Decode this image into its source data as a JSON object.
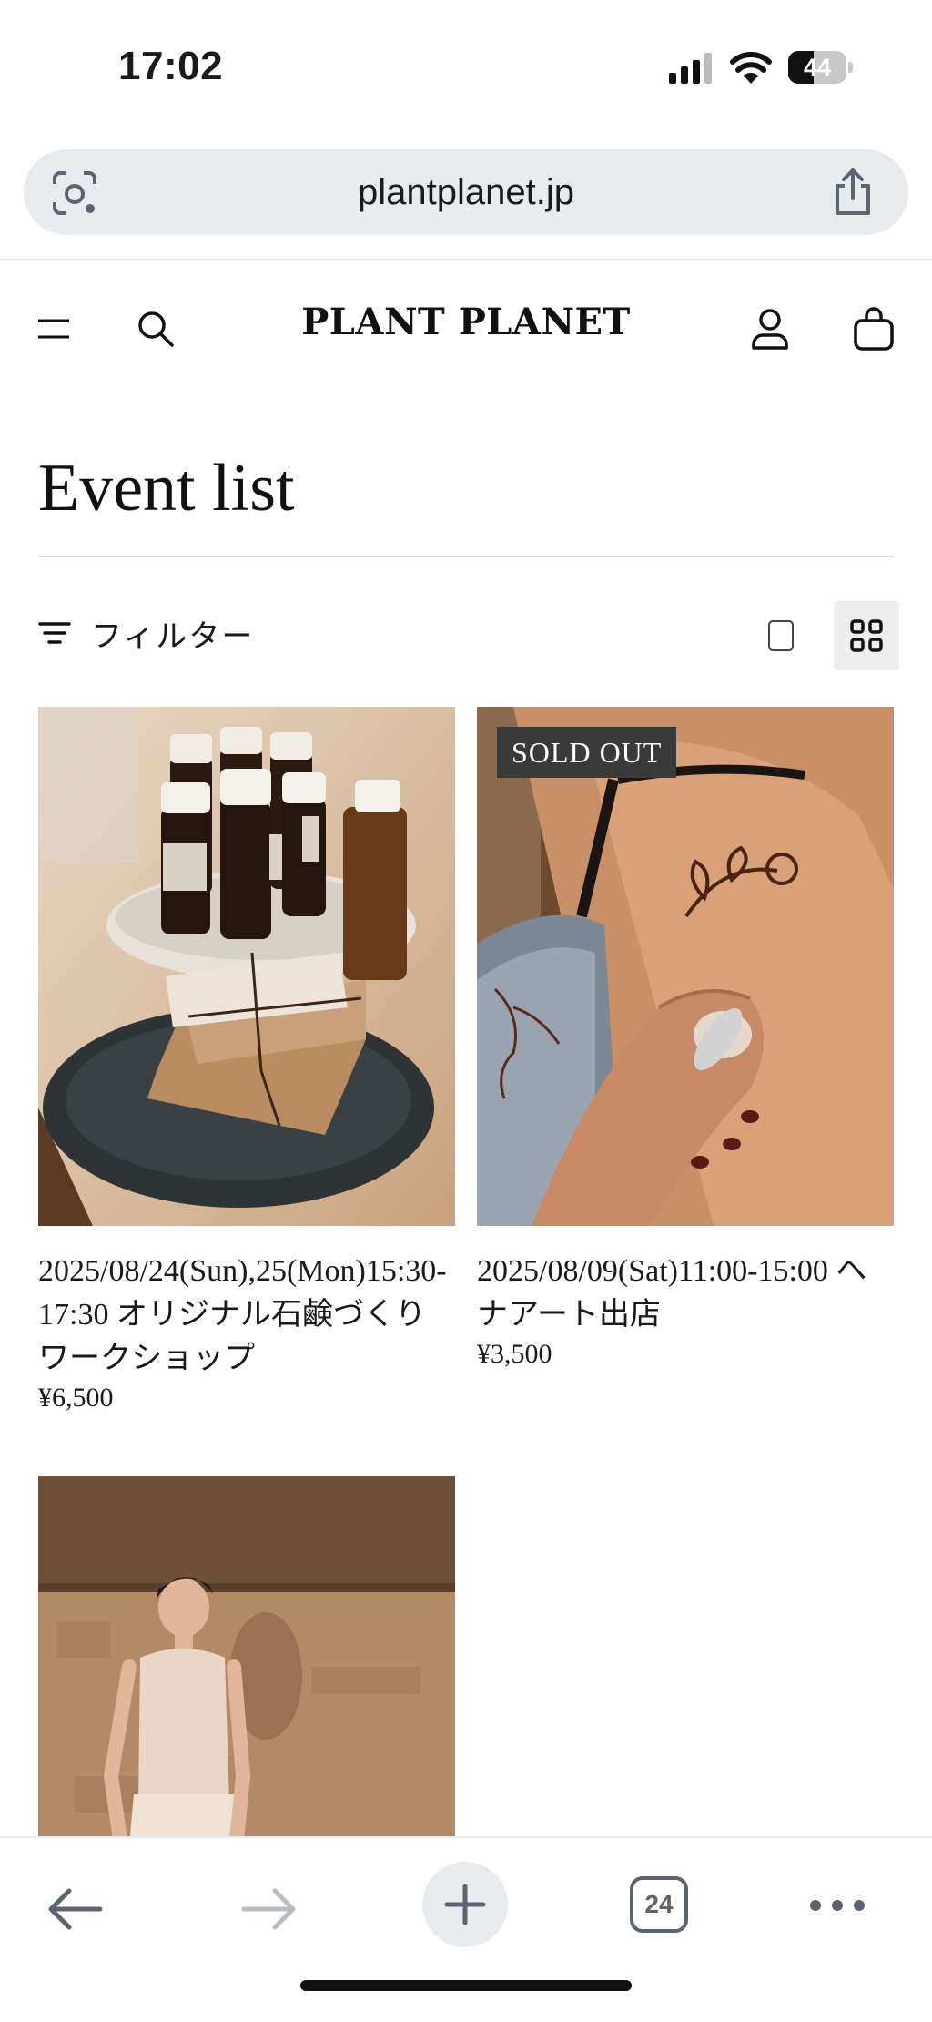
{
  "status": {
    "time": "17:02",
    "battery": "44",
    "battery_level": 0.44
  },
  "browser": {
    "url": "plantplanet.jp",
    "tab_count": "24"
  },
  "header": {
    "logo": "PLANT PLANET"
  },
  "page": {
    "title": "Event list",
    "filter_label": "フィルター"
  },
  "products": [
    {
      "title": "2025/08/24(Sun),25(Mon)15:30-17:30 オリジナル石鹸づくりワークショップ",
      "price": "¥6,500",
      "badge": ""
    },
    {
      "title": "2025/08/09(Sat)11:00-15:00 ヘナアート出店",
      "price": "¥3,500",
      "badge": "SOLD OUT"
    },
    {
      "title": "",
      "price": "",
      "badge": ""
    }
  ],
  "colors": {
    "accent": "#1a1a1a",
    "badge_bg": "#3a3a3a",
    "url_bar_bg": "#e8ebee"
  }
}
